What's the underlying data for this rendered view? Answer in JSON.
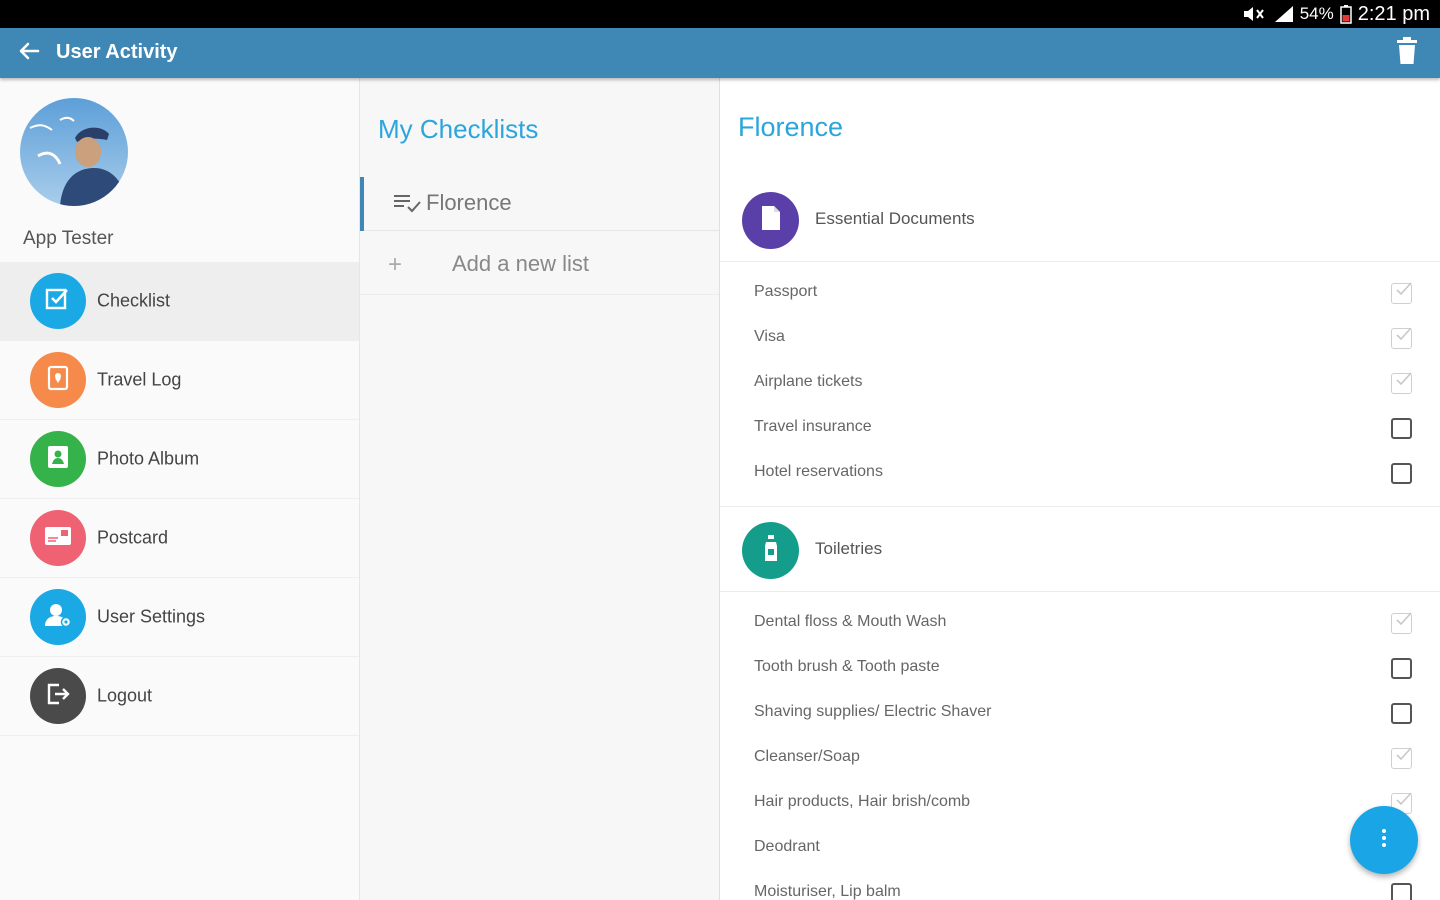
{
  "status_bar": {
    "battery": "54%",
    "time": "2:21 pm"
  },
  "toolbar": {
    "title": "User Activity",
    "back_icon": "arrow-left-icon",
    "delete_icon": "trash-icon"
  },
  "profile": {
    "name": "App Tester"
  },
  "menu": [
    {
      "label": "Checklist",
      "icon": "checklist-icon",
      "color": "#1ba9e6",
      "active": true
    },
    {
      "label": "Travel Log",
      "icon": "map-marker-icon",
      "color": "#f58a4b",
      "active": false
    },
    {
      "label": "Photo Album",
      "icon": "photo-icon",
      "color": "#36b24a",
      "active": false
    },
    {
      "label": "Postcard",
      "icon": "postcard-icon",
      "color": "#ee6274",
      "active": false
    },
    {
      "label": "User Settings",
      "icon": "user-settings-icon",
      "color": "#1ba9e6",
      "active": false
    },
    {
      "label": "Logout",
      "icon": "logout-icon",
      "color": "#4a4a4a",
      "active": false
    }
  ],
  "checklists": {
    "title": "My Checklists",
    "items": [
      {
        "label": "Florence",
        "icon": "list-check-icon"
      }
    ],
    "add_label": "Add a new list"
  },
  "detail": {
    "title": "Florence",
    "categories": [
      {
        "label": "Essential Documents",
        "icon": "document-icon",
        "color": "#5b3fa8",
        "items": [
          {
            "label": "Passport",
            "checked": true
          },
          {
            "label": "Visa",
            "checked": true
          },
          {
            "label": "Airplane tickets",
            "checked": true
          },
          {
            "label": "Travel insurance",
            "checked": false
          },
          {
            "label": "Hotel reservations",
            "checked": false
          }
        ]
      },
      {
        "label": "Toiletries",
        "icon": "bottle-icon",
        "color": "#149d8a",
        "items": [
          {
            "label": "Dental floss & Mouth Wash",
            "checked": true
          },
          {
            "label": "Tooth brush & Tooth paste",
            "checked": false
          },
          {
            "label": "Shaving supplies/ Electric Shaver",
            "checked": false
          },
          {
            "label": "Cleanser/Soap",
            "checked": true
          },
          {
            "label": "Hair products, Hair brish/comb",
            "checked": true
          },
          {
            "label": "Deodrant",
            "checked": true
          },
          {
            "label": "Moisturiser, Lip balm",
            "checked": false
          }
        ]
      }
    ]
  },
  "fab": {
    "icon": "more-vertical-icon",
    "color": "#1aa6e6"
  }
}
